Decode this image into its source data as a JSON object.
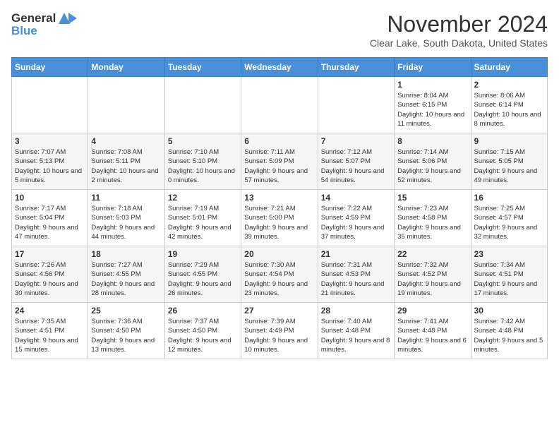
{
  "logo": {
    "text1": "General",
    "text2": "Blue"
  },
  "header": {
    "title": "November 2024",
    "subtitle": "Clear Lake, South Dakota, United States"
  },
  "days_of_week": [
    "Sunday",
    "Monday",
    "Tuesday",
    "Wednesday",
    "Thursday",
    "Friday",
    "Saturday"
  ],
  "weeks": [
    [
      {
        "day": "",
        "info": ""
      },
      {
        "day": "",
        "info": ""
      },
      {
        "day": "",
        "info": ""
      },
      {
        "day": "",
        "info": ""
      },
      {
        "day": "",
        "info": ""
      },
      {
        "day": "1",
        "info": "Sunrise: 8:04 AM\nSunset: 6:15 PM\nDaylight: 10 hours and 11 minutes."
      },
      {
        "day": "2",
        "info": "Sunrise: 8:06 AM\nSunset: 6:14 PM\nDaylight: 10 hours and 8 minutes."
      }
    ],
    [
      {
        "day": "3",
        "info": "Sunrise: 7:07 AM\nSunset: 5:13 PM\nDaylight: 10 hours and 5 minutes."
      },
      {
        "day": "4",
        "info": "Sunrise: 7:08 AM\nSunset: 5:11 PM\nDaylight: 10 hours and 2 minutes."
      },
      {
        "day": "5",
        "info": "Sunrise: 7:10 AM\nSunset: 5:10 PM\nDaylight: 10 hours and 0 minutes."
      },
      {
        "day": "6",
        "info": "Sunrise: 7:11 AM\nSunset: 5:09 PM\nDaylight: 9 hours and 57 minutes."
      },
      {
        "day": "7",
        "info": "Sunrise: 7:12 AM\nSunset: 5:07 PM\nDaylight: 9 hours and 54 minutes."
      },
      {
        "day": "8",
        "info": "Sunrise: 7:14 AM\nSunset: 5:06 PM\nDaylight: 9 hours and 52 minutes."
      },
      {
        "day": "9",
        "info": "Sunrise: 7:15 AM\nSunset: 5:05 PM\nDaylight: 9 hours and 49 minutes."
      }
    ],
    [
      {
        "day": "10",
        "info": "Sunrise: 7:17 AM\nSunset: 5:04 PM\nDaylight: 9 hours and 47 minutes."
      },
      {
        "day": "11",
        "info": "Sunrise: 7:18 AM\nSunset: 5:03 PM\nDaylight: 9 hours and 44 minutes."
      },
      {
        "day": "12",
        "info": "Sunrise: 7:19 AM\nSunset: 5:01 PM\nDaylight: 9 hours and 42 minutes."
      },
      {
        "day": "13",
        "info": "Sunrise: 7:21 AM\nSunset: 5:00 PM\nDaylight: 9 hours and 39 minutes."
      },
      {
        "day": "14",
        "info": "Sunrise: 7:22 AM\nSunset: 4:59 PM\nDaylight: 9 hours and 37 minutes."
      },
      {
        "day": "15",
        "info": "Sunrise: 7:23 AM\nSunset: 4:58 PM\nDaylight: 9 hours and 35 minutes."
      },
      {
        "day": "16",
        "info": "Sunrise: 7:25 AM\nSunset: 4:57 PM\nDaylight: 9 hours and 32 minutes."
      }
    ],
    [
      {
        "day": "17",
        "info": "Sunrise: 7:26 AM\nSunset: 4:56 PM\nDaylight: 9 hours and 30 minutes."
      },
      {
        "day": "18",
        "info": "Sunrise: 7:27 AM\nSunset: 4:55 PM\nDaylight: 9 hours and 28 minutes."
      },
      {
        "day": "19",
        "info": "Sunrise: 7:29 AM\nSunset: 4:55 PM\nDaylight: 9 hours and 26 minutes."
      },
      {
        "day": "20",
        "info": "Sunrise: 7:30 AM\nSunset: 4:54 PM\nDaylight: 9 hours and 23 minutes."
      },
      {
        "day": "21",
        "info": "Sunrise: 7:31 AM\nSunset: 4:53 PM\nDaylight: 9 hours and 21 minutes."
      },
      {
        "day": "22",
        "info": "Sunrise: 7:32 AM\nSunset: 4:52 PM\nDaylight: 9 hours and 19 minutes."
      },
      {
        "day": "23",
        "info": "Sunrise: 7:34 AM\nSunset: 4:51 PM\nDaylight: 9 hours and 17 minutes."
      }
    ],
    [
      {
        "day": "24",
        "info": "Sunrise: 7:35 AM\nSunset: 4:51 PM\nDaylight: 9 hours and 15 minutes."
      },
      {
        "day": "25",
        "info": "Sunrise: 7:36 AM\nSunset: 4:50 PM\nDaylight: 9 hours and 13 minutes."
      },
      {
        "day": "26",
        "info": "Sunrise: 7:37 AM\nSunset: 4:50 PM\nDaylight: 9 hours and 12 minutes."
      },
      {
        "day": "27",
        "info": "Sunrise: 7:39 AM\nSunset: 4:49 PM\nDaylight: 9 hours and 10 minutes."
      },
      {
        "day": "28",
        "info": "Sunrise: 7:40 AM\nSunset: 4:48 PM\nDaylight: 9 hours and 8 minutes."
      },
      {
        "day": "29",
        "info": "Sunrise: 7:41 AM\nSunset: 4:48 PM\nDaylight: 9 hours and 6 minutes."
      },
      {
        "day": "30",
        "info": "Sunrise: 7:42 AM\nSunset: 4:48 PM\nDaylight: 9 hours and 5 minutes."
      }
    ]
  ]
}
